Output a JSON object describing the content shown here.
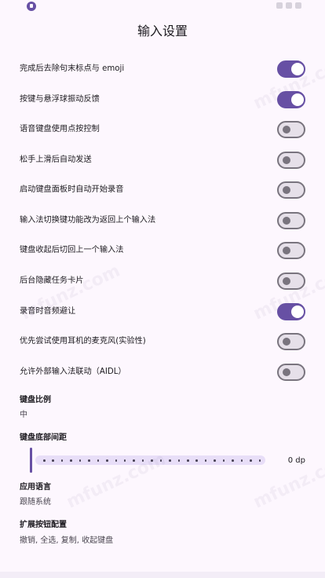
{
  "title": "输入设置",
  "settings": [
    {
      "label": "完成后去除句末标点与 emoji",
      "on": true
    },
    {
      "label": "按键与悬浮球振动反馈",
      "on": true
    },
    {
      "label": "语音键盘使用点按控制",
      "on": false
    },
    {
      "label": "松手上滑后自动发送",
      "on": false
    },
    {
      "label": "启动键盘面板时自动开始录音",
      "on": false
    },
    {
      "label": "输入法切换键功能改为返回上个输入法",
      "on": false
    },
    {
      "label": "键盘收起后切回上一个输入法",
      "on": false
    },
    {
      "label": "后台隐藏任务卡片",
      "on": false
    },
    {
      "label": "录音时音频避让",
      "on": true
    },
    {
      "label": "优先尝试使用耳机的麦克风(实验性)",
      "on": false
    },
    {
      "label": "允许外部输入法联动（AIDL）",
      "on": false
    }
  ],
  "keyboard_ratio": {
    "title": "键盘比例",
    "value": "中"
  },
  "keyboard_bottom_gap": {
    "title": "键盘底部间距",
    "value": "0 dp",
    "fraction": 0
  },
  "app_language": {
    "title": "应用语言",
    "value": "跟随系统"
  },
  "extension_buttons": {
    "title": "扩展按钮配置",
    "value": "撤销, 全选, 复制, 收起键盘"
  },
  "watermark": "mfunz.com",
  "colors": {
    "accent": "#6750a4",
    "background": "#fdf7fe",
    "track_off": "#e6e0e9",
    "outline": "#79747e"
  }
}
